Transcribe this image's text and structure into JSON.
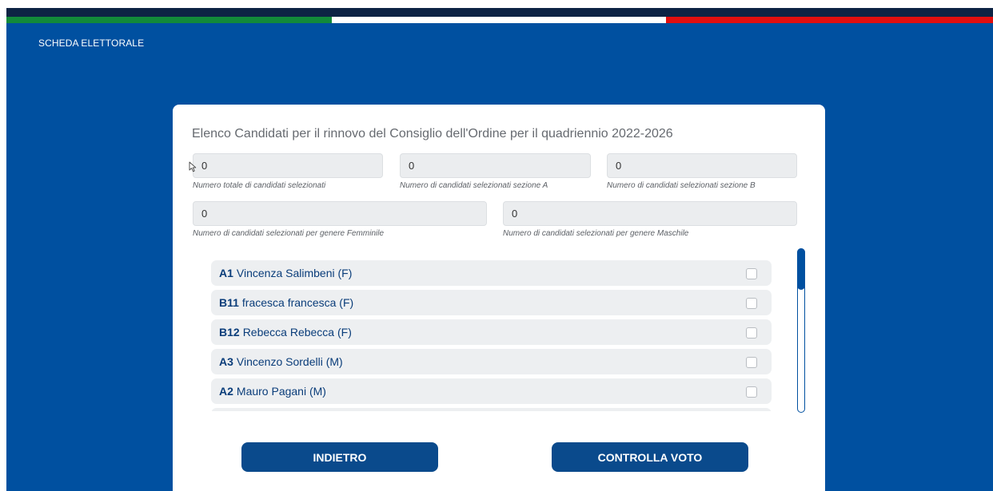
{
  "header": {
    "app_title": "SCHEDA ELETTORALE"
  },
  "flag": {
    "colors": [
      "#128a3a",
      "#ffffff",
      "#e10f0f"
    ],
    "band_color": "#0d2344"
  },
  "theme": {
    "background": "#0050a0",
    "button": "#0a4a8c",
    "candidate_text": "#0a3d7a"
  },
  "card": {
    "title": "Elenco Candidati per il rinnovo del Consiglio dell'Ordine per il quadriennio 2022-2026"
  },
  "counters": [
    {
      "value": "0",
      "hint": "Numero totale di candidati selezionati"
    },
    {
      "value": "0",
      "hint": "Numero di candidati selezionati sezione A"
    },
    {
      "value": "0",
      "hint": "Numero di candidati selezionati sezione B"
    },
    {
      "value": "0",
      "hint": "Numero di candidati selezionati per genere Femminile"
    },
    {
      "value": "0",
      "hint": "Numero di candidati selezionati per genere Maschile"
    }
  ],
  "candidates": [
    {
      "code": "A1",
      "name": "Vincenza Salimbeni (F)",
      "checked": false
    },
    {
      "code": "B11",
      "name": "fracesca francesca (F)",
      "checked": false
    },
    {
      "code": "B12",
      "name": "Rebecca Rebecca (F)",
      "checked": false
    },
    {
      "code": "A3",
      "name": "Vincenzo Sordelli (M)",
      "checked": false
    },
    {
      "code": "A2",
      "name": "Mauro Pagani (M)",
      "checked": false
    }
  ],
  "icons": {
    "cursor": "mouse-pointer-icon",
    "checkbox": "checkbox-icon"
  },
  "actions": {
    "back_label": "INDIETRO",
    "check_label": "CONTROLLA VOTO"
  }
}
